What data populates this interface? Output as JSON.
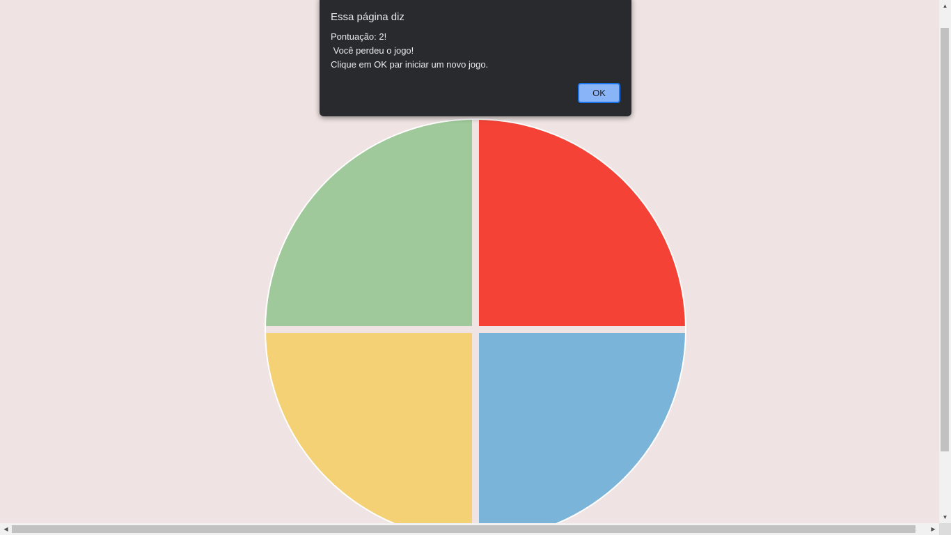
{
  "dialog": {
    "title": "Essa página diz",
    "message_lines": [
      "Pontuação: 2!",
      " Você perdeu o jogo!",
      "Clique em OK par iniciar um novo jogo."
    ],
    "ok_label": "OK"
  },
  "game": {
    "pads": [
      {
        "position": "top-left",
        "color": "#9fc99a"
      },
      {
        "position": "top-right",
        "color": "#f44336"
      },
      {
        "position": "bottom-left",
        "color": "#f4d174"
      },
      {
        "position": "bottom-right",
        "color": "#7ab4d9"
      }
    ],
    "background": "#efe3e3"
  },
  "scrollbars": {
    "up_icon": "▲",
    "down_icon": "▼",
    "left_icon": "◀",
    "right_icon": "▶"
  }
}
